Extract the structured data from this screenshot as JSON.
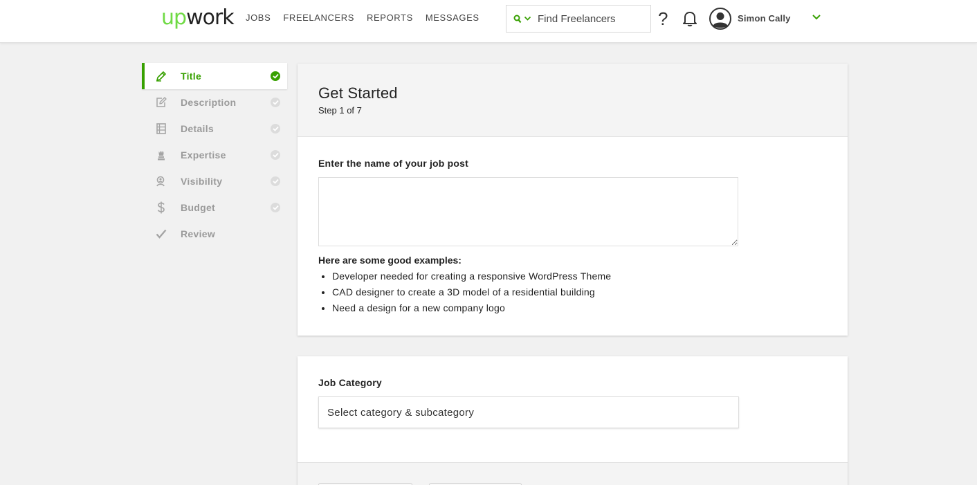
{
  "header": {
    "logo_up": "up",
    "logo_work": "work",
    "nav": [
      "JOBS",
      "FREELANCERS",
      "REPORTS",
      "MESSAGES"
    ],
    "search_placeholder": "Find Freelancers",
    "help": "?",
    "user_name": "Simon Cally"
  },
  "sidebar": {
    "steps": [
      {
        "label": "Title",
        "icon": "pencil-icon",
        "active": true
      },
      {
        "label": "Description",
        "icon": "edit-note-icon"
      },
      {
        "label": "Details",
        "icon": "list-icon"
      },
      {
        "label": "Expertise",
        "icon": "chess-piece-icon"
      },
      {
        "label": "Visibility",
        "icon": "search-person-icon"
      },
      {
        "label": "Budget",
        "icon": "dollar-icon"
      },
      {
        "label": "Review",
        "icon": "checkmark-icon"
      }
    ]
  },
  "main": {
    "title": "Get Started",
    "step": "Step 1 of 7",
    "name_label": "Enter the name of your job post",
    "examples_title": "Here are some good examples:",
    "examples": [
      "Developer needed for creating a responsive WordPress Theme",
      "CAD designer to create a 3D model of a residential building",
      "Need a design for a new company logo"
    ],
    "category_label": "Job Category",
    "category_placeholder": "Select category & subcategory"
  },
  "colors": {
    "accent": "#37a000",
    "logo_green": "#6fda44"
  }
}
